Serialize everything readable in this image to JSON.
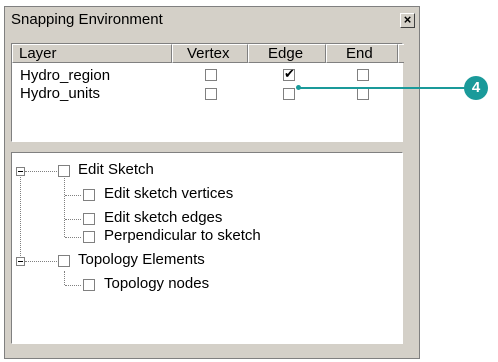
{
  "window": {
    "title": "Snapping Environment",
    "close_glyph": "×"
  },
  "layer_table": {
    "columns": [
      "Layer",
      "Vertex",
      "Edge",
      "End"
    ],
    "rows": [
      {
        "name": "Hydro_region",
        "vertex": false,
        "edge": true,
        "end": false
      },
      {
        "name": "Hydro_units",
        "vertex": false,
        "edge": false,
        "end": false
      }
    ]
  },
  "tree": {
    "groups": [
      {
        "label": "Edit Sketch",
        "children": [
          "Edit sketch vertices",
          "Edit sketch edges",
          "Perpendicular to sketch"
        ]
      },
      {
        "label": "Topology Elements",
        "children": [
          "Topology nodes"
        ]
      }
    ]
  },
  "callout": {
    "number": "4",
    "color": "#1a9a9a"
  }
}
